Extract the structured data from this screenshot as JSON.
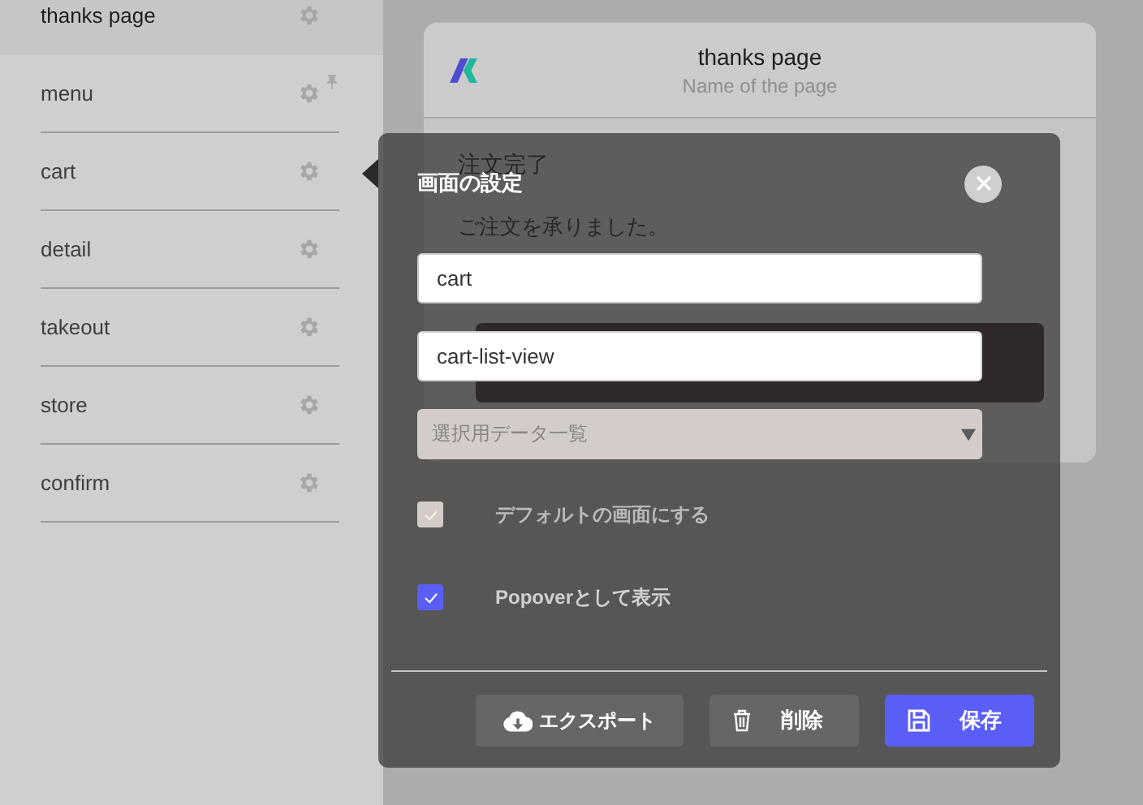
{
  "sidebar": {
    "items": [
      {
        "label": "thanks page",
        "selected": true,
        "pinned": false
      },
      {
        "label": "menu",
        "selected": false,
        "pinned": true
      },
      {
        "label": "cart",
        "selected": false,
        "pinned": false
      },
      {
        "label": "detail",
        "selected": false,
        "pinned": false
      },
      {
        "label": "takeout",
        "selected": false,
        "pinned": false
      },
      {
        "label": "store",
        "selected": false,
        "pinned": false
      },
      {
        "label": "confirm",
        "selected": false,
        "pinned": false
      }
    ]
  },
  "page_card": {
    "title": "thanks page",
    "subtitle": "Name of the page",
    "heading": "注文完了",
    "message": "ご注文を承りました。"
  },
  "popover": {
    "title": "画面の設定",
    "name_field": {
      "value": "cart"
    },
    "id_field": {
      "value": "cart-list-view"
    },
    "data_select": {
      "placeholder": "選択用データ一覧"
    },
    "options": [
      {
        "label": "デフォルトの画面にする",
        "checked": true,
        "disabled": true
      },
      {
        "label": "Popoverとして表示",
        "checked": true,
        "disabled": false
      }
    ],
    "buttons": [
      {
        "kind": "export",
        "label": "エクスポート"
      },
      {
        "kind": "delete",
        "label": "削除"
      },
      {
        "kind": "save",
        "label": "保存"
      }
    ]
  }
}
